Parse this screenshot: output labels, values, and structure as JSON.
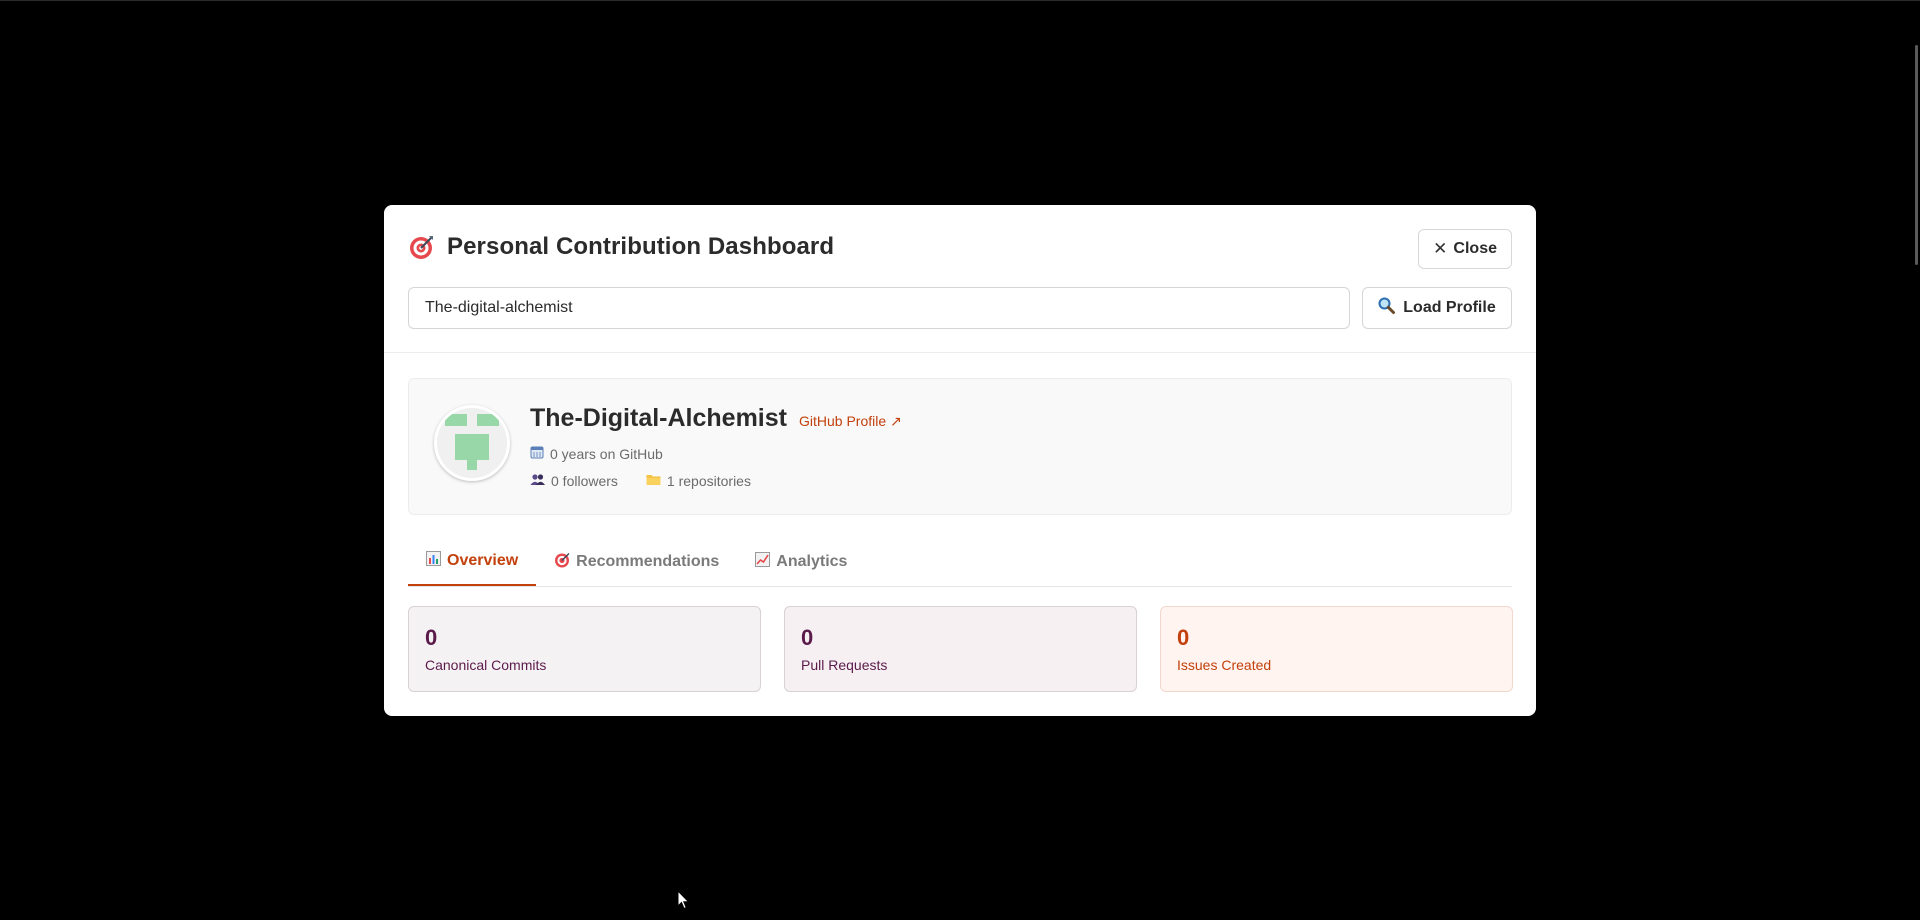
{
  "dialog": {
    "title": "Personal Contribution Dashboard",
    "title_icon": "target-icon",
    "close_label": "Close",
    "close_icon": "close-icon"
  },
  "search": {
    "value": "The-digital-alchemist",
    "button_label": "Load Profile",
    "button_icon": "magnifier-icon"
  },
  "profile": {
    "name": "The-Digital-Alchemist",
    "link_label": "GitHub Profile ↗",
    "years_text": "0 years on GitHub",
    "followers_text": "0 followers",
    "repos_text": "1 repositories",
    "avatar_color": "#98d8a8"
  },
  "tabs": [
    {
      "label": "Overview",
      "icon": "bar-chart-icon",
      "active": true
    },
    {
      "label": "Recommendations",
      "icon": "target-icon",
      "active": false
    },
    {
      "label": "Analytics",
      "icon": "line-chart-icon",
      "active": false
    }
  ],
  "stats": [
    {
      "value": "0",
      "label": "Canonical Commits"
    },
    {
      "value": "0",
      "label": "Pull Requests"
    },
    {
      "value": "0",
      "label": "Issues Created"
    }
  ],
  "colors": {
    "accent": "#c2410c",
    "stat_text": "#5b1b4a",
    "overlay": "#000000"
  }
}
